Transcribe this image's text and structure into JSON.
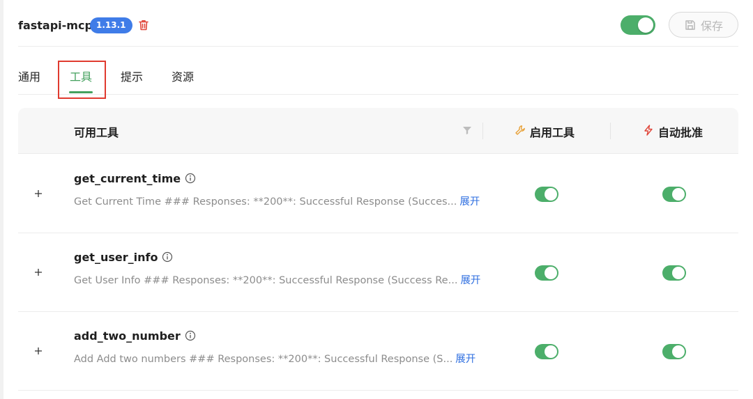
{
  "header": {
    "server_name": "fastapi-mcp",
    "version": "1.13.1",
    "server_enabled": true,
    "save_label": "保存"
  },
  "tabs": [
    {
      "label": "通用",
      "active": false
    },
    {
      "label": "工具",
      "active": true
    },
    {
      "label": "提示",
      "active": false
    },
    {
      "label": "资源",
      "active": false
    }
  ],
  "table": {
    "col_available": "可用工具",
    "col_enable": "启用工具",
    "col_auto_approve": "自动批准",
    "rows": [
      {
        "name": "get_current_time",
        "description": "Get Current Time ### Responses: **200**: Successful Response (Succes...",
        "expand_label": "展开",
        "enabled": true,
        "auto_approve": true
      },
      {
        "name": "get_user_info",
        "description": "Get User Info ### Responses: **200**: Successful Response (Success Re...",
        "expand_label": "展开",
        "enabled": true,
        "auto_approve": true
      },
      {
        "name": "add_two_number",
        "description": "Add Add two numbers ### Responses: **200**: Successful Response (S...",
        "expand_label": "展开",
        "enabled": true,
        "auto_approve": true
      }
    ]
  },
  "colors": {
    "accent_green": "#44a15e",
    "toggle_green": "#4cae6a",
    "badge_blue": "#3f7ce8",
    "link_blue": "#2f6fe0",
    "delete_red": "#e0463a",
    "highlight_red": "#e03a2f",
    "wrench_orange": "#e8a23a"
  }
}
